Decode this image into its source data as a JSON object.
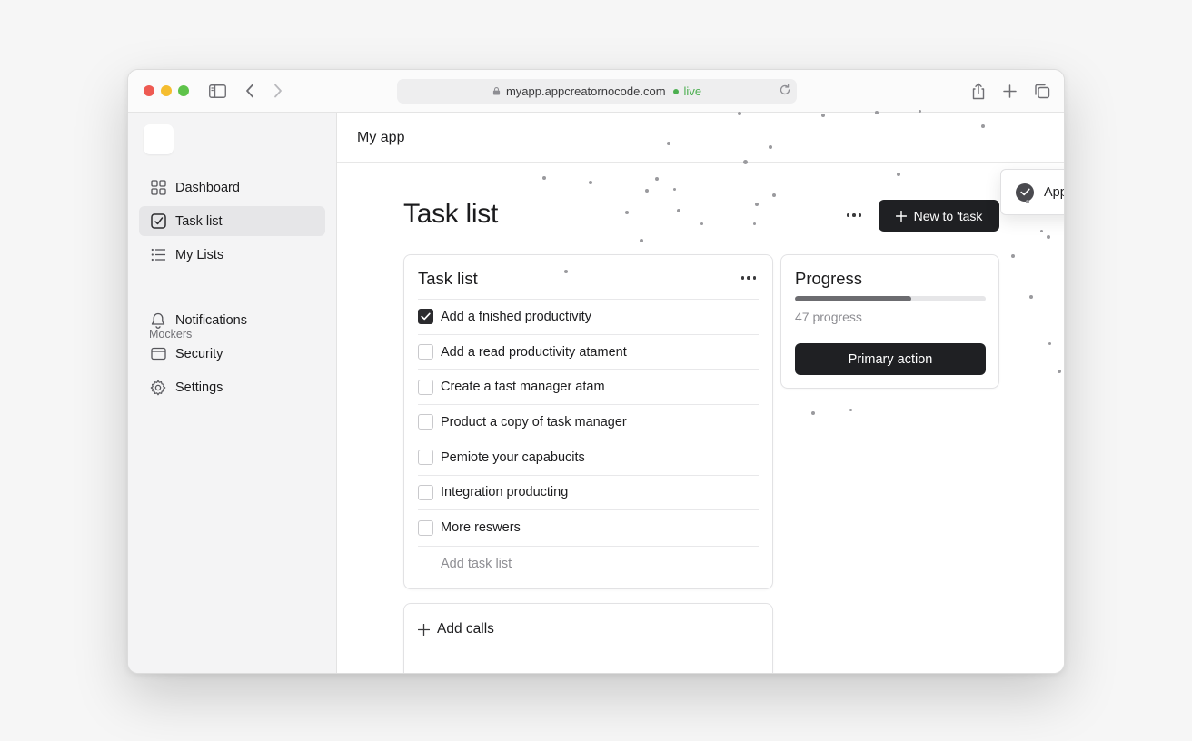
{
  "browser": {
    "url": "myapp.appcreatornocode.com",
    "live_label": "live",
    "icons": [
      "sidebar-toggle-icon",
      "back-icon",
      "forward-icon",
      "lock-icon",
      "reload-icon",
      "share-icon",
      "new-tab-icon",
      "tabs-overview-icon"
    ]
  },
  "sidebar": {
    "items": [
      {
        "label": "Dashboard",
        "icon": "grid-icon",
        "active": false
      },
      {
        "label": "Task list",
        "icon": "checkbox-icon",
        "active": true
      },
      {
        "label": "My Lists",
        "icon": "list-icon",
        "active": false
      }
    ],
    "section_label": "Mockers",
    "section_items": [
      {
        "label": "Notifications",
        "icon": "bell-icon"
      },
      {
        "label": "Security",
        "icon": "card-icon"
      },
      {
        "label": "Settings",
        "icon": "gear-icon"
      }
    ]
  },
  "header": {
    "app_title": "My app"
  },
  "page": {
    "title": "Task list",
    "new_button_label": "New to 'task"
  },
  "tasks_card": {
    "title": "Task list",
    "tasks": [
      {
        "label": "Add a fnished productivity",
        "checked": true
      },
      {
        "label": "Add a read productivity atament",
        "checked": false
      },
      {
        "label": "Create a tast manager atam",
        "checked": false
      },
      {
        "label": "Product a copy of task manager",
        "checked": false
      },
      {
        "label": "Pemiote your capabucits",
        "checked": false
      },
      {
        "label": "Integration producting",
        "checked": false
      },
      {
        "label": "More reswers",
        "checked": false
      }
    ],
    "add_placeholder": "Add task list"
  },
  "calls_card": {
    "label": "Add calls"
  },
  "progress_card": {
    "title": "Progress",
    "fraction": 0.61,
    "text": "47 progress",
    "button_label": "Primary action"
  },
  "toast": {
    "message": "App published successfully"
  },
  "colors": {
    "accent_dark": "#1f2023",
    "live_green": "#4caf50",
    "traffic_red": "#ee5a52",
    "traffic_yellow": "#f5bd2f",
    "traffic_green": "#5ec34a"
  }
}
